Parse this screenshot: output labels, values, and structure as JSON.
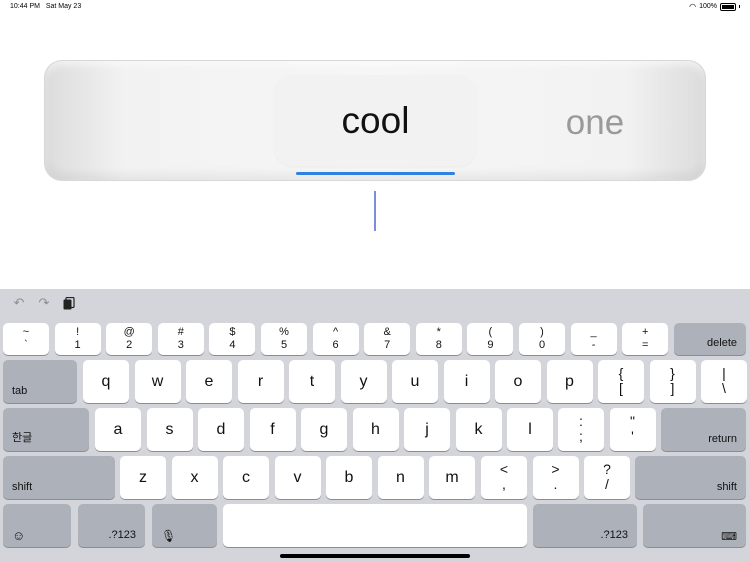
{
  "status_bar": {
    "time": "10:44 PM",
    "date": "Sat May 23",
    "battery": "100%"
  },
  "candidates": {
    "selected": "cool",
    "next": "one",
    "accent_color": "#2f80e0"
  },
  "toolbar": {
    "undo_icon": "undo-icon",
    "redo_icon": "redo-icon",
    "paste_icon": "clipboard-icon"
  },
  "keyboard": {
    "number_row": [
      {
        "top": "~",
        "bot": "`"
      },
      {
        "top": "!",
        "bot": "1"
      },
      {
        "top": "@",
        "bot": "2"
      },
      {
        "top": "#",
        "bot": "3"
      },
      {
        "top": "$",
        "bot": "4"
      },
      {
        "top": "%",
        "bot": "5"
      },
      {
        "top": "^",
        "bot": "6"
      },
      {
        "top": "&",
        "bot": "7"
      },
      {
        "top": "*",
        "bot": "8"
      },
      {
        "top": "(",
        "bot": "9"
      },
      {
        "top": ")",
        "bot": "0"
      },
      {
        "top": "_",
        "bot": "-"
      },
      {
        "top": "+",
        "bot": "="
      }
    ],
    "delete_label": "delete",
    "tab_label": "tab",
    "row_q": [
      "q",
      "w",
      "e",
      "r",
      "t",
      "y",
      "u",
      "i",
      "o",
      "p"
    ],
    "row_q_extra": [
      {
        "top": "{",
        "bot": "["
      },
      {
        "top": "}",
        "bot": "]"
      },
      {
        "top": "|",
        "bot": "\\"
      }
    ],
    "hangul_label": "한글",
    "row_a": [
      "a",
      "s",
      "d",
      "f",
      "g",
      "h",
      "j",
      "k",
      "l"
    ],
    "row_a_extra": [
      {
        "top": ":",
        "bot": ";"
      },
      {
        "top": "\"",
        "bot": "'"
      }
    ],
    "return_label": "return",
    "shift_label": "shift",
    "row_z": [
      "z",
      "x",
      "c",
      "v",
      "b",
      "n",
      "m"
    ],
    "row_z_extra": [
      {
        "top": "<",
        "bot": ","
      },
      {
        "top": ">",
        "bot": "."
      },
      {
        "top": "?",
        "bot": "/"
      }
    ],
    "emoji_icon": "emoji-icon",
    "numbers_label": ".?123",
    "mic_icon": "microphone-icon",
    "dismiss_icon": "keyboard-dismiss-icon"
  }
}
